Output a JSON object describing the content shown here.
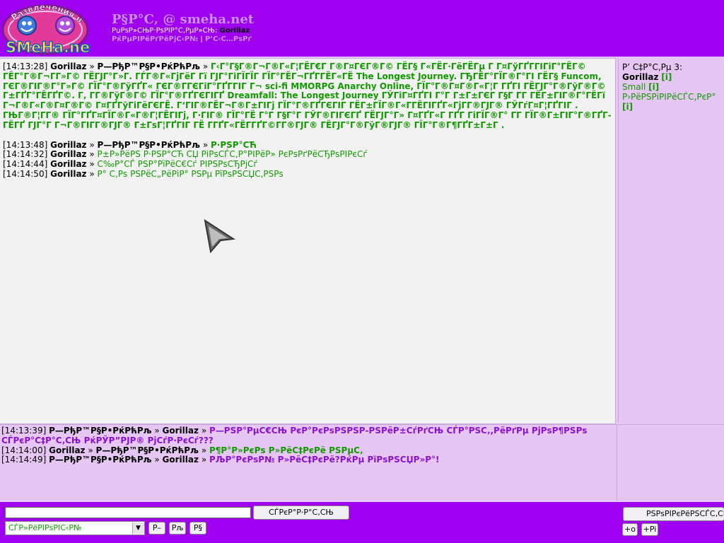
{
  "header": {
    "logo_text_top": "Развлечения на",
    "logo_text_bottom": "SMeHa.net",
    "title": "Р§Р°С‚ @ smeha.net",
    "welcome_label": "РџРѕР»СЊР·РѕРІР°С‚РµР»СЊ:",
    "welcome_user": "Gorillaz",
    "link_left": "РќРµРІРёРґРёРјС‹Р№",
    "link_sep": "|",
    "link_right": "Р’С‹С…РѕРґ"
  },
  "main_chat": {
    "messages": [
      {
        "time": "[14:13:28]",
        "from": "Gorillaz",
        "sep": "»",
        "to": "Р—РђР™Р§Р•РќРћРљ",
        "sep2": "»",
        "text": "Г‹Г°Г§Г®Г¬Г®Г«Г¦ГЁГ€Г Г®Г¤ГЄГ®Г© ГЁГ§ Г«ГЁГ·ГёГЁГµ Г Г¤ГўГҐГ­ГІГіГ°ГЁГ© ГЁГ°Г®Г¬Г­Г»Г© ГЁГЈГ°Г»Г­. ГЃГ®Г«ГјГёГ Гї ГЈГ°ГіГЇГЇГ  ГЇГ°ГЁГ¬ГҐГ­ГЁГ«ГЁ The Longest Journey. ГЂГЁГ°ГЇГ®Г°ГІ ГЁГ§ Funcom, ГЄГ®ГІГ®Г°Г»Г© ГЇГ°Г®ГўГҐГ« ГЄГ®Г­ГЄГіГ°ГҐГ­ГІГ Г¬ sci-fi MMORPG Anarchy Online, ГЇГ°Г®Г¤Г®Г«Г¦Г ГҐГІ ГЁГЈГ°Г®ГўГ®Г© Г±ГҐГ°ГЁГҐГ©. Г‚ Г­Г®ГўГ®Г© ГЇГ°Г®ГҐГЄГІГҐ Dreamfall: The Longest Journey ГЎГіГ¤ГҐГІ Г°Г Г±Г±ГЄГ Г§Г Г­Г  ГЁГ±ГІГ®Г°ГЁГї Г¬Г®Г«Г®Г¤Г®Г© Г¤ГҐГўГіГёГЄГЁ. Г‘ГІГ®ГЁГ¬Г®Г±ГІГј ГЇГ°Г®ГҐГЄГІГ  ГЁГ±ГЇГ®Г«Г­ГЁГІГҐГ«ГјГ­Г®ГЈГ® ГЎГѓГ¤Г¦ГҐГІГ . ГЊГ®Г¦Г­Г® ГЇГ°ГҐГ¤ГЇГ®Г«Г®Г¦ГЁГІГј, Г·ГІГ® ГЇГ°ГЁ Г°Г Г§Г°Г ГЎГ®ГІГЄГҐ ГЁГЈГ°Г» Г¤ГҐГ«Г ГҐГ­ ГіГЇГ®Г° Г­Г  ГЇГ®Г±ГІГ°Г®ГҐГ­ГЁГҐ ГЈГ°Г Г¬Г®ГІГ­Г®ГЈГ® Г±ГѕГ¦ГҐГІГ  ГЁ Г­ГҐГ«ГЁГ­ГҐГ©Г­Г®ГЈГ® ГЁГЈГ°Г®ГўГ®ГЈГ® ГЇГ°Г®Г¶ГҐГ±Г±Г ."
      },
      {
        "time": "[14:13:48]",
        "from": "Gorillaz",
        "sep": "»",
        "to": "Р—РђР™Р§Р•РќРћРљ",
        "sep2": "»",
        "text": "Р·РЅР°СЋ",
        "bold": true
      },
      {
        "time": "[14:14:32]",
        "from": "Gorillaz",
        "sep": "»",
        "text": "Р±Р»РёРЅ Р·РЅР°СЋ СЏ РіРѕСЃС‚Р°РІРёР» РєРѕРґРёСЂРѕРІРєСѓ",
        "bold": false
      },
      {
        "time": "[14:14:44]",
        "from": "Gorillaz",
        "sep": "»",
        "text": "С‰Р°СЃ РЅР°РїРёС€Сѓ РІРЅРѕСЂРјСѓ",
        "bold": false
      },
      {
        "time": "[14:14:50]",
        "from": "Gorillaz",
        "sep": "»",
        "text": "Р° С‚Рѕ РЅРёС„РёРіР° РЅРµ РїРѕРЅСЏС‚РЅРѕ",
        "bold": false
      }
    ]
  },
  "userlist": {
    "heading": "Р’ С‡Р°С‚Рµ 3:",
    "users": [
      {
        "name": "Gorillaz",
        "info": "[i]",
        "style": "bold"
      },
      {
        "name": "Small",
        "info": "[i]",
        "style": "green"
      },
      {
        "name": "Р›РёРЅРіРІРёСЃС‚РєР°",
        "info": "[i]",
        "style": "green"
      }
    ]
  },
  "private_chat": {
    "messages": [
      {
        "time": "[14:13:39]",
        "from": "Р—РђР™Р§Р•РќРћРљ",
        "sep": "»",
        "to": "Gorillaz",
        "sep2": "»",
        "text": "Р—РЅР°РµС€СЊ РєР°РєРѕРЅРЅР-РЅРёР±СѓРґСЊ СЃР°РЅС‚,РёРґРµ РјРѕР¶РЅРѕ СЃРєР°С‡Р°С‚СЊ РќРЎР”РЈР® РјСѓР·РєСѓ???"
      },
      {
        "time": "[14:14:00]",
        "from": "Gorillaz",
        "sep": "»",
        "to": "Р—РђР™Р§Р•РќРћРљ",
        "sep2": "»",
        "text": "Р¶Р°Р»РєРѕ Р»РёС‡РєРё РЅРµС‚"
      },
      {
        "time": "[14:14:49]",
        "from": "Р—РђР™Р§Р•РќРћРљ",
        "sep": "»",
        "to": "Gorillaz",
        "sep2": "»",
        "text": "РЉР°РєРѕР№ Р»РёС‡РєРё?РќРµ РїРѕРЅСЏР»Р°!"
      }
    ]
  },
  "input_bar": {
    "message_value": "",
    "send_label": "СЃРєР°Р·Р°С‚СЊ",
    "mode_value": "СЃР»РёРІРѕРІС‹Р№",
    "btn_a": "Р–",
    "btn_b": "Рљ",
    "btn_c": "Р§",
    "settings_label": "РЅРѕРІРєРёРЅСЃС‚СЊ",
    "plus_o": "+o",
    "plus_pi": "+Pi"
  }
}
